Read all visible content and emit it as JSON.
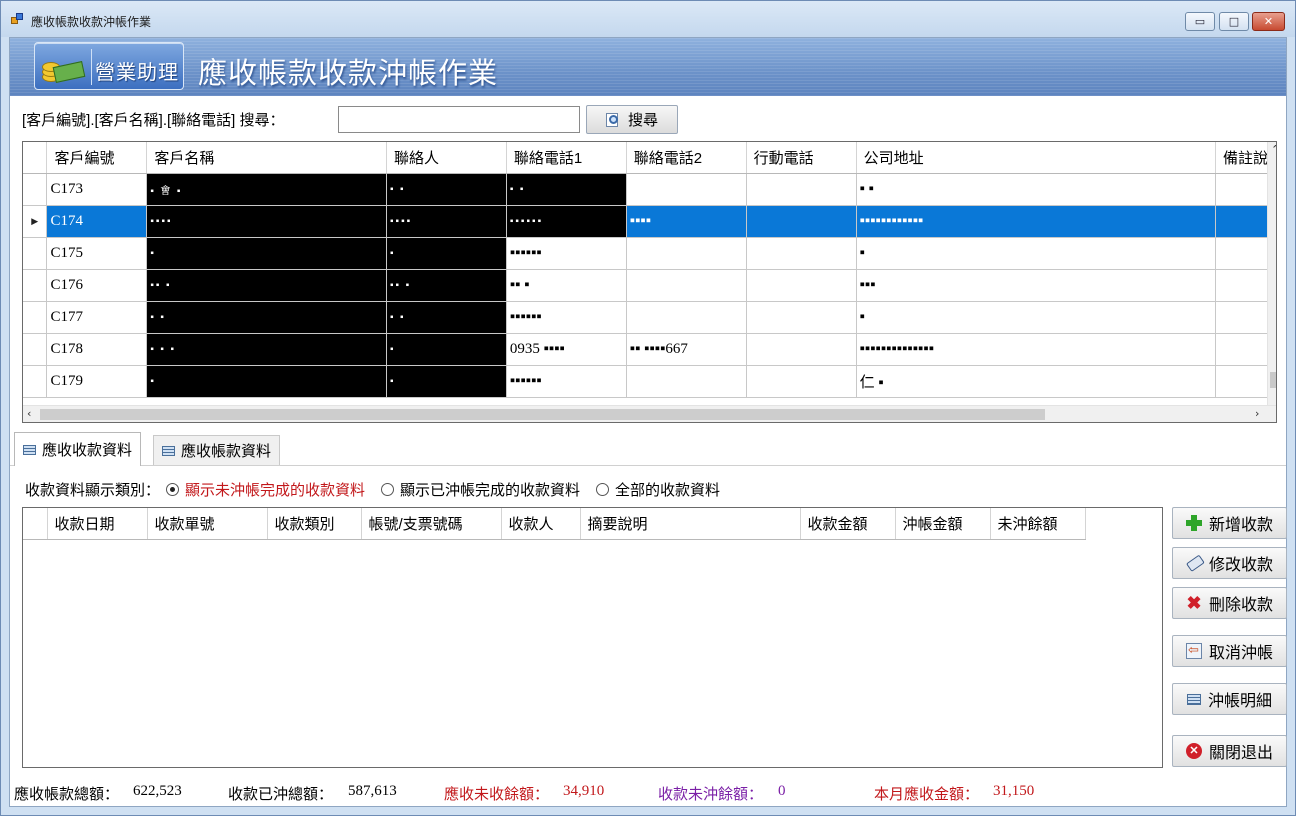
{
  "window": {
    "title": "應收帳款收款沖帳作業",
    "minimize": "▭",
    "maximize": "□",
    "close": "✕"
  },
  "banner": {
    "badge_label": "營業助理",
    "title": "應收帳款收款沖帳作業"
  },
  "search": {
    "label": "[客戶編號].[客戶名稱].[聯絡電話] 搜尋：",
    "value": "",
    "button_label": "搜尋"
  },
  "customer_grid": {
    "columns": [
      "客戶編號",
      "客戶名稱",
      "聯絡人",
      "聯絡電話1",
      "聯絡電話2",
      "行動電話",
      "公司地址",
      "備註說"
    ],
    "selected_row_index": 1,
    "rows": [
      {
        "id": "C173",
        "name": "▪ 會 ▪",
        "contact": "▪ ▪",
        "phone1": "▪ ▪",
        "phone2": "",
        "mobile": "",
        "address": "▪ ▪"
      },
      {
        "id": "C174",
        "name": "▪▪▪▪",
        "contact": "▪▪▪▪",
        "phone1": "▪▪▪▪▪▪",
        "phone2": "▪▪▪▪",
        "mobile": "",
        "address": "▪▪▪▪▪▪▪▪▪▪▪▪"
      },
      {
        "id": "C175",
        "name": "▪",
        "contact": "▪",
        "phone1": "▪▪▪▪▪▪",
        "phone2": "",
        "mobile": "",
        "address": "▪"
      },
      {
        "id": "C176",
        "name": "▪▪ ▪",
        "contact": "▪▪ ▪",
        "phone1": "▪▪ ▪",
        "phone2": "",
        "mobile": "",
        "address": "▪▪▪"
      },
      {
        "id": "C177",
        "name": "▪ ▪",
        "contact": "▪ ▪",
        "phone1": "▪▪▪▪▪▪",
        "phone2": "",
        "mobile": "",
        "address": "▪"
      },
      {
        "id": "C178",
        "name": "▪ ▪ ▪",
        "contact": "▪",
        "phone1": "0935 ▪▪▪▪",
        "phone2": "▪▪ ▪▪▪▪667",
        "mobile": "",
        "address": "▪▪▪▪▪▪▪▪▪▪▪▪▪▪"
      },
      {
        "id": "C179",
        "name": "▪",
        "contact": "▪",
        "phone1": "▪▪▪▪▪▪",
        "phone2": "",
        "mobile": "",
        "address": "仁 ▪"
      }
    ]
  },
  "tabs": [
    {
      "label": "應收收款資料",
      "active": true
    },
    {
      "label": "應收帳款資料",
      "active": false
    }
  ],
  "filter": {
    "label": "收款資料顯示類別：",
    "options": [
      {
        "label": "顯示未沖帳完成的收款資料",
        "selected": true
      },
      {
        "label": "顯示已沖帳完成的收款資料",
        "selected": false
      },
      {
        "label": "全部的收款資料",
        "selected": false
      }
    ]
  },
  "payment_grid": {
    "columns": [
      "收款日期",
      "收款單號",
      "收款類別",
      "帳號/支票號碼",
      "收款人",
      "摘要說明",
      "收款金額",
      "沖帳金額",
      "未沖餘額"
    ],
    "rows": []
  },
  "actions": {
    "add": "新增收款",
    "edit": "修改收款",
    "delete": "刪除收款",
    "cancel_offset": "取消沖帳",
    "offset_detail": "沖帳明細",
    "close": "關閉退出"
  },
  "status": {
    "receivable_total_label": "應收帳款總額：",
    "receivable_total": "622,523",
    "offset_total_label": "收款已沖總額：",
    "offset_total": "587,613",
    "uncollected_label": "應收未收餘額：",
    "uncollected": "34,910",
    "unoffset_label": "收款未沖餘額：",
    "unoffset": "0",
    "month_label": "本月應收金額：",
    "month": "31,150"
  },
  "colors": {
    "selection": "#0a78d7",
    "alert_red": "#c2181b",
    "purple": "#7a1fa6",
    "banner": "#6c92c9"
  }
}
